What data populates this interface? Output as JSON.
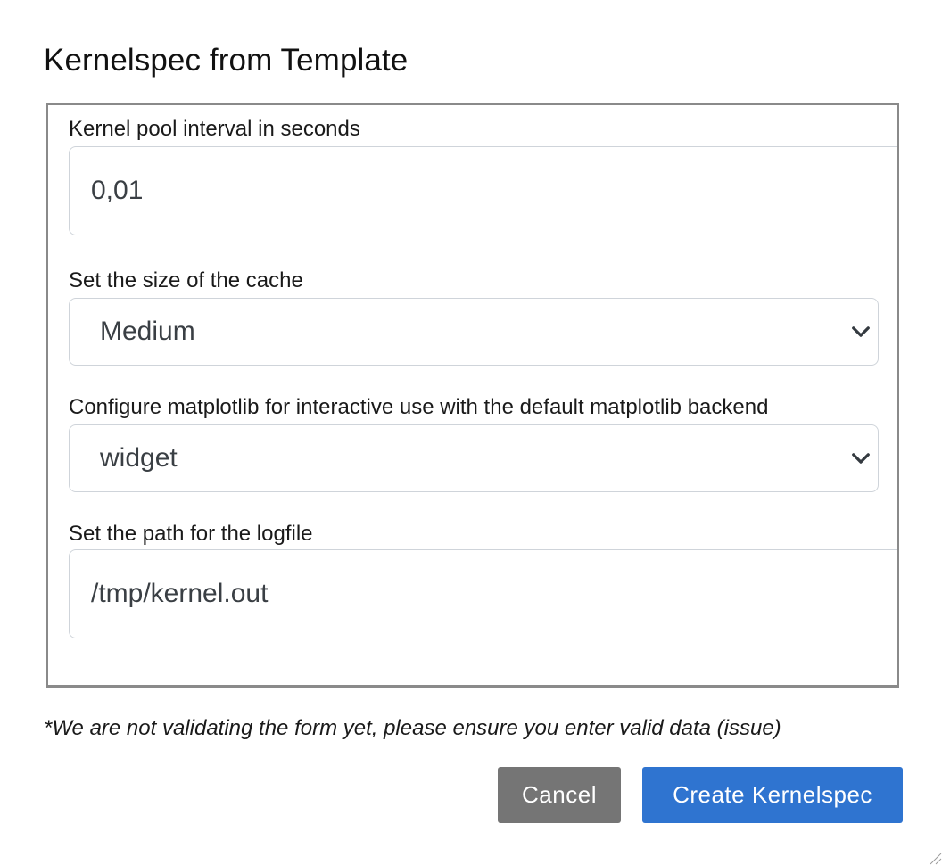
{
  "dialog": {
    "title": "Kernelspec from Template"
  },
  "form": {
    "pool_interval": {
      "label": "Kernel pool interval in seconds",
      "value": "0,01"
    },
    "cache_size": {
      "label": "Set the size of the cache",
      "selected": "Medium",
      "icon": "chevron-down-icon"
    },
    "matplotlib": {
      "label": "Configure matplotlib for interactive use with the default matplotlib backend",
      "selected": "widget",
      "icon": "chevron-down-icon"
    },
    "logfile": {
      "label": "Set the path for the logfile",
      "value": "/tmp/kernel.out"
    }
  },
  "note": "*We are not validating the form yet, please ensure you enter valid data (issue)",
  "buttons": {
    "cancel_label": "Cancel",
    "create_label": "Create Kernelspec"
  },
  "colors": {
    "primary": "#2f74d0",
    "secondary": "#757575"
  }
}
